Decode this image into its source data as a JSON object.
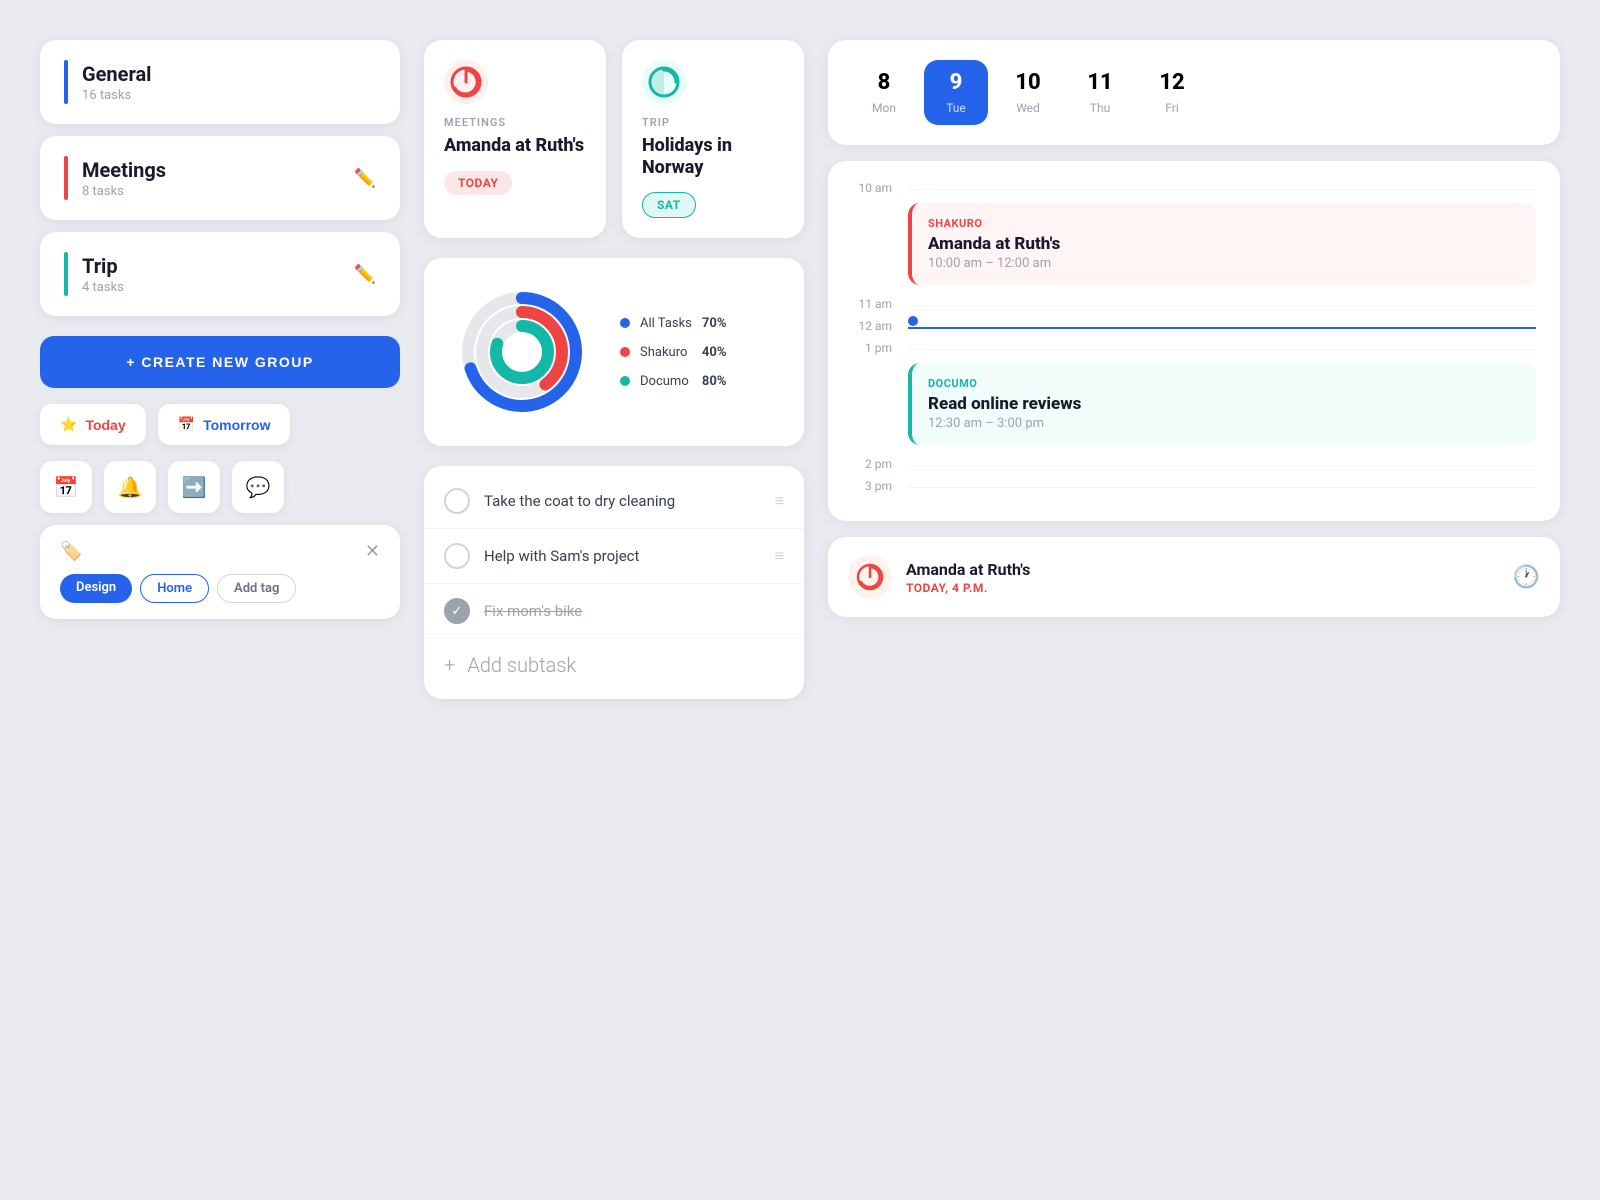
{
  "groups": [
    {
      "id": "general",
      "name": "General",
      "tasks": "16 tasks",
      "color": "#2563eb"
    },
    {
      "id": "meetings",
      "name": "Meetings",
      "tasks": "8 tasks",
      "color": "#ef4444"
    },
    {
      "id": "trip",
      "name": "Trip",
      "tasks": "4 tasks",
      "color": "#14b8a6"
    }
  ],
  "create_btn": "+ CREATE NEW GROUP",
  "filters": {
    "today": "Today",
    "tomorrow": "Tomorrow"
  },
  "tags": {
    "design": "Design",
    "home": "Home",
    "add": "Add tag"
  },
  "events": [
    {
      "category": "MEETINGS",
      "title": "Amanda at Ruth's",
      "badge": "TODAY",
      "badge_type": "today",
      "icon": "🔴"
    },
    {
      "category": "TRIP",
      "title": "Holidays in Norway",
      "badge": "SAT",
      "badge_type": "sat",
      "icon": "🔵"
    }
  ],
  "chart": {
    "legend": [
      {
        "label": "All Tasks",
        "pct": "70%",
        "color": "#2563eb"
      },
      {
        "label": "Shakuro",
        "pct": "40%",
        "color": "#ef4444"
      },
      {
        "label": "Documo",
        "pct": "80%",
        "color": "#14b8a6"
      }
    ]
  },
  "tasks": [
    {
      "text": "Take the coat to dry cleaning",
      "done": false
    },
    {
      "text": "Help with Sam's project",
      "done": false
    },
    {
      "text": "Fix mom's bike",
      "done": true
    }
  ],
  "add_subtask": "Add subtask",
  "calendar": {
    "days": [
      {
        "num": "8",
        "name": "Mon",
        "active": false
      },
      {
        "num": "9",
        "name": "Tue",
        "active": true
      },
      {
        "num": "10",
        "name": "Wed",
        "active": false
      },
      {
        "num": "11",
        "name": "Thu",
        "active": false
      },
      {
        "num": "12",
        "name": "Fri",
        "active": false
      }
    ]
  },
  "schedule": {
    "times": [
      "10 am",
      "11 am",
      "12 am",
      "1 pm",
      "2 pm",
      "3 pm"
    ],
    "events": [
      {
        "org": "SHAKURO",
        "org_color": "red",
        "name": "Amanda at Ruth's",
        "time": "10:00 am – 12:00 am",
        "color": "red"
      },
      {
        "org": "DOCUMO",
        "org_color": "teal",
        "name": "Read online reviews",
        "time": "12:30 am – 3:00 pm",
        "color": "teal"
      }
    ]
  },
  "reminder": {
    "title": "Amanda at Ruth's",
    "subtitle": "TODAY, 4 P.M."
  }
}
